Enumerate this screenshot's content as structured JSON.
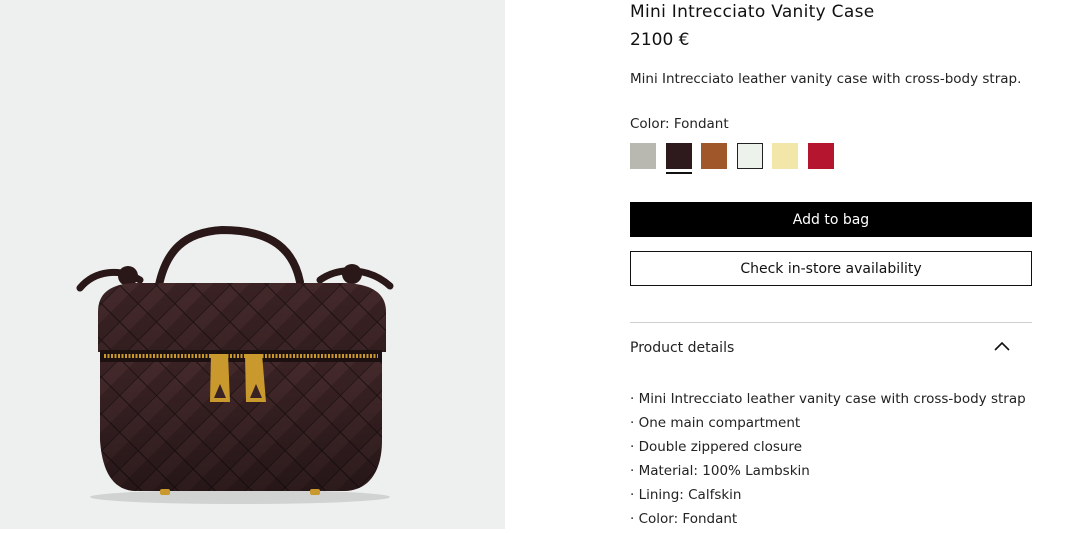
{
  "product": {
    "title": "Mini Intrecciato Vanity Case",
    "price": "2100 €",
    "description": "Mini Intrecciato leather vanity case with cross-body strap.",
    "color_label": "Color: Fondant",
    "swatches": [
      {
        "name": "swatch-grey",
        "color": "#b8b8b0"
      },
      {
        "name": "swatch-fondant",
        "color": "#2e1a1c",
        "selected": true
      },
      {
        "name": "swatch-caramel",
        "color": "#a0582a"
      },
      {
        "name": "swatch-white",
        "color": "#eef2ec"
      },
      {
        "name": "swatch-butter",
        "color": "#f2e6a8"
      },
      {
        "name": "swatch-red",
        "color": "#b5152e"
      }
    ]
  },
  "actions": {
    "add_to_bag": "Add to bag",
    "check_store": "Check in-store availability"
  },
  "details": {
    "heading": "Product details",
    "items": [
      "· Mini Intrecciato leather vanity case with cross-body strap",
      "· One main compartment",
      "· Double zippered closure",
      "· Material: 100% Lambskin",
      "· Lining: Calfskin",
      "· Color: Fondant"
    ]
  },
  "colors": {
    "image_bg": "#eef0ef",
    "bag_leather": "#3a2224",
    "hardware_gold": "#c9992e"
  }
}
